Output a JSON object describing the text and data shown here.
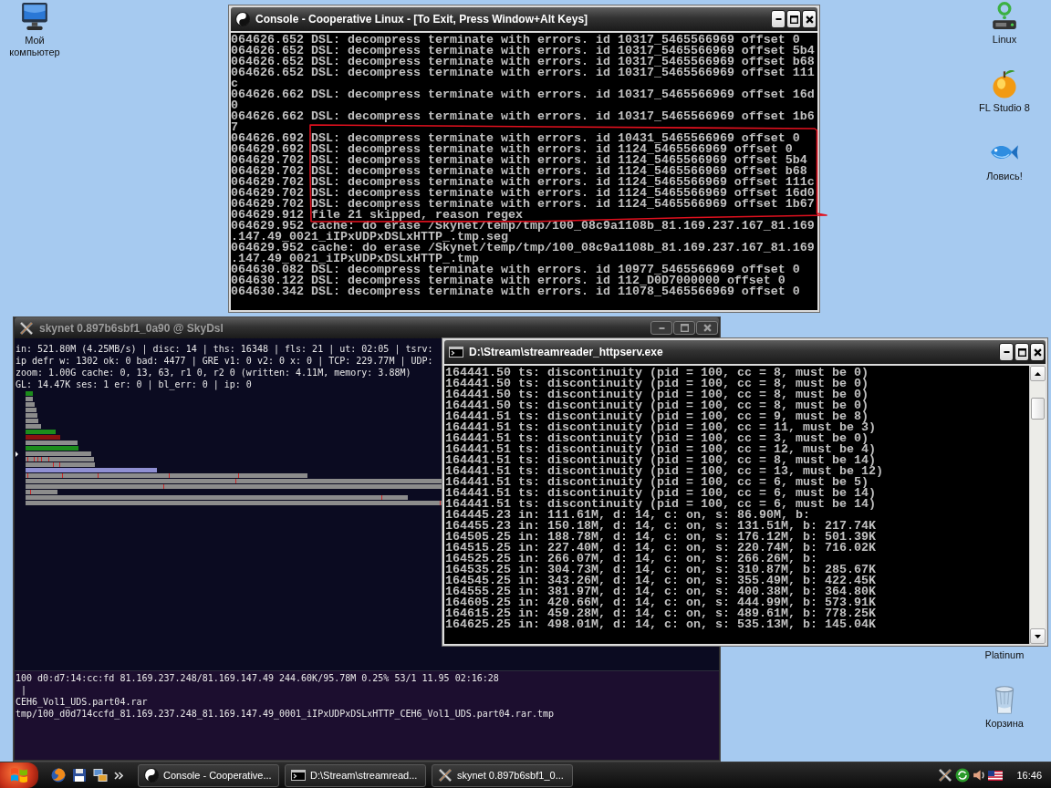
{
  "desktop_icons_left": [
    {
      "label": "Мой компьютер",
      "kind": "computer"
    }
  ],
  "desktop_icons_right": [
    {
      "label": "Linux",
      "kind": "device"
    },
    {
      "label": "FL Studio 8",
      "kind": "fruit"
    },
    {
      "label": "Ловись!",
      "kind": "fish"
    },
    {
      "label": "Platinum",
      "kind": "label-only"
    },
    {
      "label": "Корзина",
      "kind": "trash"
    }
  ],
  "console_window": {
    "title": "Console - Cooperative Linux - [To Exit, Press Window+Alt Keys]",
    "active": true,
    "lines": [
      "064626.652 DSL: decompress terminate with errors. id 10317_5465566969 offset 0",
      "064626.652 DSL: decompress terminate with errors. id 10317_5465566969 offset 5b4",
      "064626.652 DSL: decompress terminate with errors. id 10317_5465566969 offset b68",
      "064626.652 DSL: decompress terminate with errors. id 10317_5465566969 offset 111",
      "c",
      "064626.662 DSL: decompress terminate with errors. id 10317_5465566969 offset 16d",
      "0",
      "064626.662 DSL: decompress terminate with errors. id 10317_5465566969 offset 1b6",
      "7",
      "064626.692 DSL: decompress terminate with errors. id 10431_5465566969 offset 0",
      "064629.692 DSL: decompress terminate with errors. id 1124_5465566969 offset 0",
      "064629.702 DSL: decompress terminate with errors. id 1124_5465566969 offset 5b4",
      "064629.702 DSL: decompress terminate with errors. id 1124_5465566969 offset b68",
      "064629.702 DSL: decompress terminate with errors. id 1124_5465566969 offset 111c",
      "064629.702 DSL: decompress terminate with errors. id 1124_5465566969 offset 16d0",
      "064629.702 DSL: decompress terminate with errors. id 1124_5465566969 offset 1b67",
      "064629.912 file 21 skipped, reason regex",
      "064629.952 cache: do erase /Skynet/temp/tmp/100_08c9a1108b_81.169.237.167_81.169",
      ".147.49_0021_iIPxUDPxDSLxHTTP_.tmp.seg",
      "064629.952 cache: do erase /Skynet/temp/tmp/100_08c9a1108b_81.169.237.167_81.169",
      ".147.49_0021_iIPxUDPxDSLxHTTP_.tmp",
      "064630.082 DSL: decompress terminate with errors. id 10977_5465566969 offset 0",
      "064630.122 DSL: decompress terminate with errors. id 112_D0D7000000 offset 0",
      "064630.342 DSL: decompress terminate with errors. id 11078_5465566969 offset 0"
    ]
  },
  "skynet_window": {
    "title": "skynet 0.897b6sbf1_0a90 @ SkyDsl",
    "active": false,
    "status_lines": [
      "in: 521.80M (4.25MB/s) | disc: 14 | ths: 16348 | fls: 21 | ut: 02:05 | tsrv:",
      "ip defr w: 1302 ok: 0 bad: 4477 | GRE v1: 0 v2: 0 x: 0 | TCP: 229.77M | UDP:",
      "zoom: 1.00G cache: 0, 13, 63, r1 0, r2 0 (written: 4.11M, memory: 3.88M)",
      "GL: 14.47K ses: 1 er: 0 | bl_err: 0 | ip: 0"
    ],
    "detail_lines": [
      "100 d0:d7:14:cc:fd 81.169.237.248/81.169.147.49 244.60K/95.78M 0.25% 53/1 11.95 02:16:28",
      " |",
      "CEH6_Vol1_UDS.part04.rar",
      "tmp/100_d0d714ccfd_81.169.237.248_81.169.147.49_0001_iIPxUDPxDSLxHTTP_CEH6_Vol1_UDS.part04.rar.tmp"
    ]
  },
  "streamreader_window": {
    "title": "D:\\Stream\\streamreader_httpserv.exe",
    "active": true,
    "lines": [
      "164441.50 ts: discontinuity (pid = 100, cc = 8, must be 0)",
      "164441.50 ts: discontinuity (pid = 100, cc = 8, must be 0)",
      "164441.50 ts: discontinuity (pid = 100, cc = 8, must be 0)",
      "164441.50 ts: discontinuity (pid = 100, cc = 8, must be 0)",
      "164441.51 ts: discontinuity (pid = 100, cc = 9, must be 8)",
      "164441.51 ts: discontinuity (pid = 100, cc = 11, must be 3)",
      "164441.51 ts: discontinuity (pid = 100, cc = 3, must be 0)",
      "164441.51 ts: discontinuity (pid = 100, cc = 12, must be 4)",
      "164441.51 ts: discontinuity (pid = 100, cc = 8, must be 14)",
      "164441.51 ts: discontinuity (pid = 100, cc = 13, must be 12)",
      "164441.51 ts: discontinuity (pid = 100, cc = 6, must be 5)",
      "164441.51 ts: discontinuity (pid = 100, cc = 6, must be 14)",
      "164441.51 ts: discontinuity (pid = 100, cc = 6, must be 14)",
      "164445.23 in: 111.61M, d: 14, c: on, s: 86.90M, b:",
      "164455.23 in: 150.18M, d: 14, c: on, s: 131.51M, b: 217.74K",
      "164505.25 in: 188.78M, d: 14, c: on, s: 176.12M, b: 501.39K",
      "164515.25 in: 227.40M, d: 14, c: on, s: 220.74M, b: 716.02K",
      "164525.25 in: 266.07M, d: 14, c: on, s: 266.26M, b:",
      "164535.25 in: 304.73M, d: 14, c: on, s: 310.87M, b: 285.67K",
      "164545.25 in: 343.26M, d: 14, c: on, s: 355.49M, b: 422.45K",
      "164555.25 in: 381.97M, d: 14, c: on, s: 400.38M, b: 364.80K",
      "164605.25 in: 420.66M, d: 14, c: on, s: 444.99M, b: 573.91K",
      "164615.25 in: 459.28M, d: 14, c: on, s: 489.61M, b: 778.25K",
      "164625.25 in: 498.01M, d: 14, c: on, s: 535.13M, b: 145.04K"
    ]
  },
  "taskbar": {
    "tasks": [
      {
        "label": "Console - Cooperative...",
        "kind": "colinux"
      },
      {
        "label": "D:\\Stream\\streamread...",
        "kind": "cmd"
      },
      {
        "label": "skynet 0.897b6sbf1_0...",
        "kind": "xwin"
      }
    ],
    "clock": "16:46"
  }
}
